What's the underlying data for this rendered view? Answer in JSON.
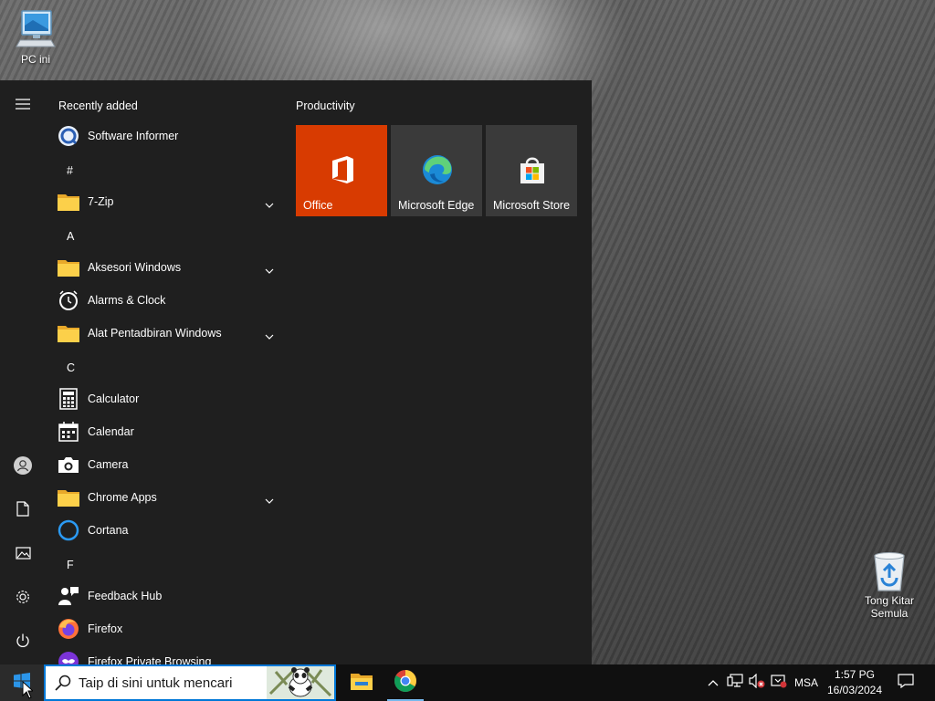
{
  "desktop": {
    "icons": [
      {
        "label": "PC ini"
      },
      {
        "label": "Tong Kitar Semula"
      }
    ]
  },
  "start_menu": {
    "recently_added_label": "Recently added",
    "apps": [
      {
        "type": "app",
        "label": "Software Informer",
        "icon": "software-informer-icon"
      },
      {
        "type": "letter",
        "label": "#"
      },
      {
        "type": "folder",
        "label": "7-Zip",
        "icon": "folder-icon"
      },
      {
        "type": "letter",
        "label": "A"
      },
      {
        "type": "folder",
        "label": "Aksesori Windows",
        "icon": "folder-icon"
      },
      {
        "type": "app",
        "label": "Alarms & Clock",
        "icon": "alarm-clock-icon"
      },
      {
        "type": "folder",
        "label": "Alat Pentadbiran Windows",
        "icon": "folder-icon"
      },
      {
        "type": "letter",
        "label": "C"
      },
      {
        "type": "app",
        "label": "Calculator",
        "icon": "calculator-icon"
      },
      {
        "type": "app",
        "label": "Calendar",
        "icon": "calendar-icon"
      },
      {
        "type": "app",
        "label": "Camera",
        "icon": "camera-icon"
      },
      {
        "type": "folder",
        "label": "Chrome Apps",
        "icon": "folder-icon"
      },
      {
        "type": "app",
        "label": "Cortana",
        "icon": "cortana-icon"
      },
      {
        "type": "letter",
        "label": "F"
      },
      {
        "type": "app",
        "label": "Feedback Hub",
        "icon": "feedback-hub-icon"
      },
      {
        "type": "app",
        "label": "Firefox",
        "icon": "firefox-icon"
      },
      {
        "type": "app",
        "label": "Firefox Private Browsing",
        "icon": "firefox-private-icon"
      }
    ],
    "tiles_group": "Productivity",
    "tiles": [
      {
        "label": "Office",
        "color": "#d83b01"
      },
      {
        "label": "Microsoft Edge",
        "color": "#3a3a3a"
      },
      {
        "label": "Microsoft Store",
        "color": "#3a3a3a"
      }
    ]
  },
  "taskbar": {
    "search_placeholder": "Taip di sini untuk mencari",
    "language": "MSA",
    "time": "1:57 PG",
    "date": "16/03/2024"
  },
  "colors": {
    "accent": "#0078d7",
    "office_tile": "#d83b01",
    "start_bg": "#1f1f1f",
    "taskbar_bg": "#101010"
  }
}
